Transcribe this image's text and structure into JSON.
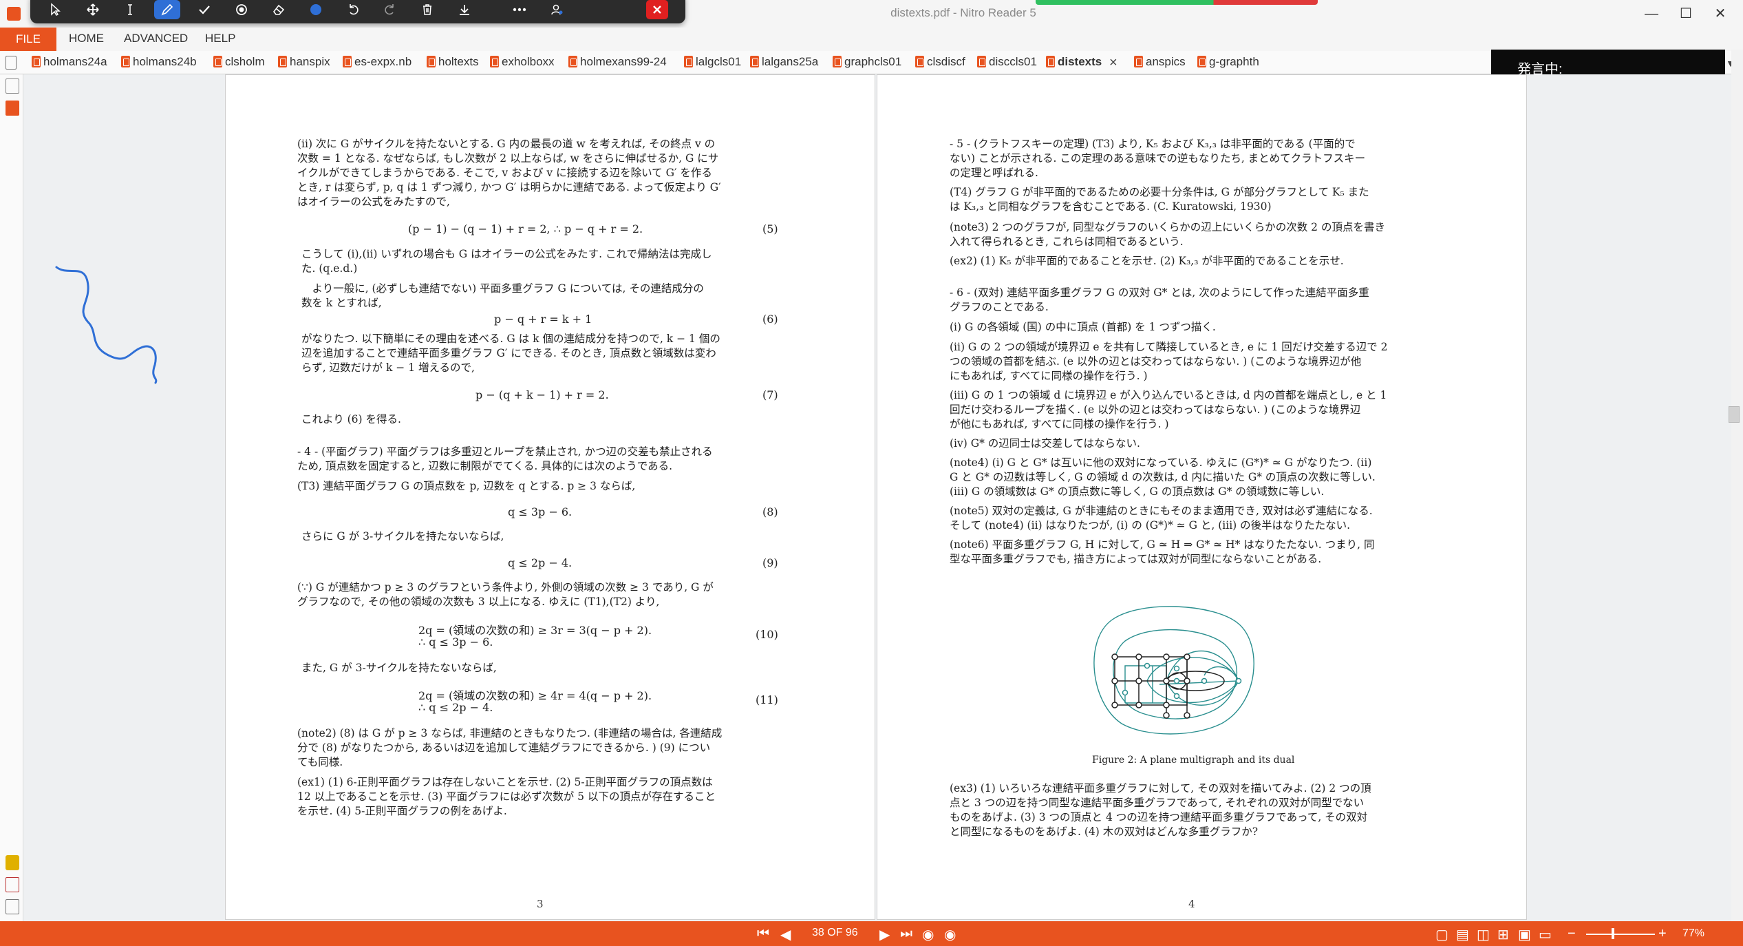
{
  "window": {
    "title": "distexts.pdf - Nitro Reader 5",
    "minimize": "—",
    "maximize": "☐",
    "close": "✕"
  },
  "ribbon": {
    "file": "FILE",
    "home": "HOME",
    "advanced": "ADVANCED",
    "help": "HELP"
  },
  "annotation_toolbar": {
    "tools": [
      "select-arrow-icon",
      "pan-icon",
      "text-cursor-icon",
      "pen-icon",
      "checkmark-icon",
      "stamp-icon",
      "eraser-icon",
      "color-dot-icon",
      "undo-icon",
      "redo-icon",
      "delete-icon",
      "download-icon",
      "more-icon",
      "account-icon",
      "close-icon"
    ],
    "active": "pen-icon",
    "active_color": "#2f6fd6"
  },
  "doc_tabs": [
    "holmans24a",
    "holmans24b",
    "clsholm",
    "hanspix",
    "es-expx.nb",
    "holtexts",
    "exholboxx",
    "holmexans99-24",
    "lalgcls01",
    "lalgans25a",
    "graphcls01",
    "clsdiscf",
    "disccls01",
    "distexts",
    "anspics",
    "g-graphth"
  ],
  "active_tab": "distexts",
  "tts_popup": "発言中:",
  "status": {
    "page_indicator": "38 OF 96",
    "zoom": "77%"
  },
  "colors": {
    "accent": "#e8531f",
    "ink": "#2f6fd6",
    "graph": "#2a8f8f"
  },
  "page3": {
    "para_ii": [
      "(ii) 次に G がサイクルを持たないとする. G 内の最長の道 w を考えれば, その終点 v の",
      "次数 = 1 となる. なぜならば, もし次数が 2 以上ならば, w をさらに伸ばせるか, G にサ",
      "イクルができてしまうからである. そこで, v および v に接続する辺を除いて G′ を作る",
      "とき, r は変らず, p, q は 1 ずつ減り, かつ G′ は明らかに連結である. よって仮定より G′",
      "はオイラーの公式をみたすので,"
    ],
    "eq5": "(p − 1) − (q − 1) + r = 2,        ∴   p − q + r = 2.",
    "eq5_num": "(5)",
    "para_qed": [
      "こうして (i),(ii) いずれの場合も G はオイラーの公式をみたす. これで帰納法は完成し",
      "た. (q.e.d.)"
    ],
    "para_general": [
      "　より一般に, (必ずしも連結でない) 平面多重グラフ G については, その連結成分の",
      "数を k とすれば,"
    ],
    "eq6": "p − q + r = k + 1",
    "eq6_num": "(6)",
    "para_reason": [
      "がなりたつ. 以下簡単にその理由を述べる. G は k 個の連結成分を持つので, k − 1 個の",
      "辺を追加することで連結平面多重グラフ G′ にできる. そのとき, 頂点数と領域数は変わ",
      "らず, 辺数だけが k − 1 増えるので,"
    ],
    "eq7": "p − (q + k − 1) + r = 2.",
    "eq7_num": "(7)",
    "para_get6": "これより (6) を得る.",
    "section4": [
      "- 4 - (平面グラフ) 平面グラフは多重辺とループを禁止され, かつ辺の交差も禁止される",
      "ため, 頂点数を固定すると, 辺数に制限がでてくる. 具体的には次のようである."
    ],
    "t3": "(T3) 連結平面グラフ G の頂点数を p, 辺数を q とする. p ≥ 3 ならば,",
    "eq8": "q ≤ 3p − 6.",
    "eq8_num": "(8)",
    "para_3cycle": "さらに G が 3-サイクルを持たないならば,",
    "eq9": "q ≤ 2p − 4.",
    "eq9_num": "(9)",
    "para_because": [
      "(∵) G が連結かつ p ≥ 3 のグラフという条件より, 外側の領域の次数 ≥ 3 であり, G が",
      "グラフなので, その他の領域の次数も 3 以上になる. ゆえに (T1),(T2) より,"
    ],
    "eq10a": "2q = (領域の次数の和) ≥ 3r = 3(q − p + 2).",
    "eq10b": "∴   q ≤ 3p − 6.",
    "eq10_num": "(10)",
    "para_also": "また, G が 3-サイクルを持たないならば,",
    "eq11a": "2q = (領域の次数の和) ≥ 4r = 4(q − p + 2).",
    "eq11b": "∴   q ≤ 2p − 4.",
    "eq11_num": "(11)",
    "note2": [
      "(note2) (8) は G が p ≥ 3 ならば, 非連結のときもなりたつ. (非連結の場合は, 各連結成",
      "分で (8) がなりたつから, あるいは辺を追加して連結グラフにできるから. ) (9) につい",
      "ても同様."
    ],
    "ex1": [
      "(ex1) (1) 6-正則平面グラフは存在しないことを示せ. (2) 5-正則平面グラフの頂点数は",
      "12 以上であることを示せ. (3) 平面グラフには必ず次数が 5 以下の頂点が存在すること",
      "を示せ. (4) 5-正則平面グラフの例をあげよ."
    ],
    "page_number": "3"
  },
  "page4": {
    "section5": [
      "- 5 - (クラトフスキーの定理) (T3) より, K₅ および K₃,₃ は非平面的である (平面的で",
      "ない) ことが示される. この定理のある意味での逆もなりたち, まとめてクラトフスキー",
      "の定理と呼ばれる."
    ],
    "t4": [
      "(T4) グラフ G が非平面的であるための必要十分条件は, G が部分グラフとして K₅ また",
      "は K₃,₃ と同相なグラフを含むことである. (C. Kuratowski, 1930)"
    ],
    "note3": [
      "(note3) 2 つのグラフが, 同型なグラフのいくらかの辺上にいくらかの次数 2 の頂点を書き",
      "入れて得られるとき, これらは同相であるという."
    ],
    "ex2": "(ex2) (1) K₅ が非平面的であることを示せ. (2) K₃,₃ が非平面的であることを示せ.",
    "section6": [
      "- 6 - (双対) 連結平面多重グラフ G の双対 G* とは, 次のようにして作った連結平面多重",
      "グラフのことである."
    ],
    "item_i": "(i) G の各領域 (国) の中に頂点 (首都) を 1 つずつ描く.",
    "item_ii": [
      "(ii) G の 2 つの領域が境界辺 e を共有して隣接しているとき, e に 1 回だけ交差する辺で 2",
      "つの領域の首都を結ぶ. (e 以外の辺とは交わってはならない. ) (このような境界辺が他",
      "にもあれば, すべてに同様の操作を行う. )"
    ],
    "item_iii": [
      "(iii) G の 1 つの領域 d に境界辺 e が入り込んでいるときは, d 内の首都を端点とし, e と 1",
      "回だけ交わるループを描く. (e 以外の辺とは交わってはならない. ) (このような境界辺",
      "が他にもあれば, すべてに同様の操作を行う. )"
    ],
    "item_iv": "(iv) G* の辺同士は交差してはならない.",
    "note4": [
      "(note4) (i) G と G* は互いに他の双対になっている. ゆえに (G*)* ≃ G がなりたつ. (ii)",
      "G と G* の辺数は等しく, G の領域 d の次数は, d 内に描いた G* の頂点の次数に等しい.",
      "(iii) G の領域数は G* の頂点数に等しく, G の頂点数は G* の領域数に等しい."
    ],
    "note5": [
      "(note5) 双対の定義は, G が非連結のときにもそのまま適用でき, 双対は必ず連結になる.",
      "そして (note4) (ii) はなりたつが, (i) の (G*)* ≃ G と, (iii) の後半はなりたたない."
    ],
    "note6": [
      "(note6) 平面多重グラフ G, H に対して, G ≃ H ⇒ G* ≃ H* はなりたたない. つまり, 同",
      "型な平面多重グラフでも, 描き方によっては双対が同型にならないことがある."
    ],
    "figure_caption": "Figure 2: A plane multigraph and its dual",
    "ex3": [
      "(ex3) (1) いろいろな連結平面多重グラフに対して, その双対を描いてみよ. (2) 2 つの頂",
      "点と 3 つの辺を持つ同型な連結平面多重グラフであって, それぞれの双対が同型でない",
      "ものをあげよ. (3) 3 つの頂点と 4 つの辺を持つ連結平面多重グラフであって, その双対",
      "と同型になるものをあげよ. (4) 木の双対はどんな多重グラフか?"
    ],
    "page_number": "4"
  }
}
